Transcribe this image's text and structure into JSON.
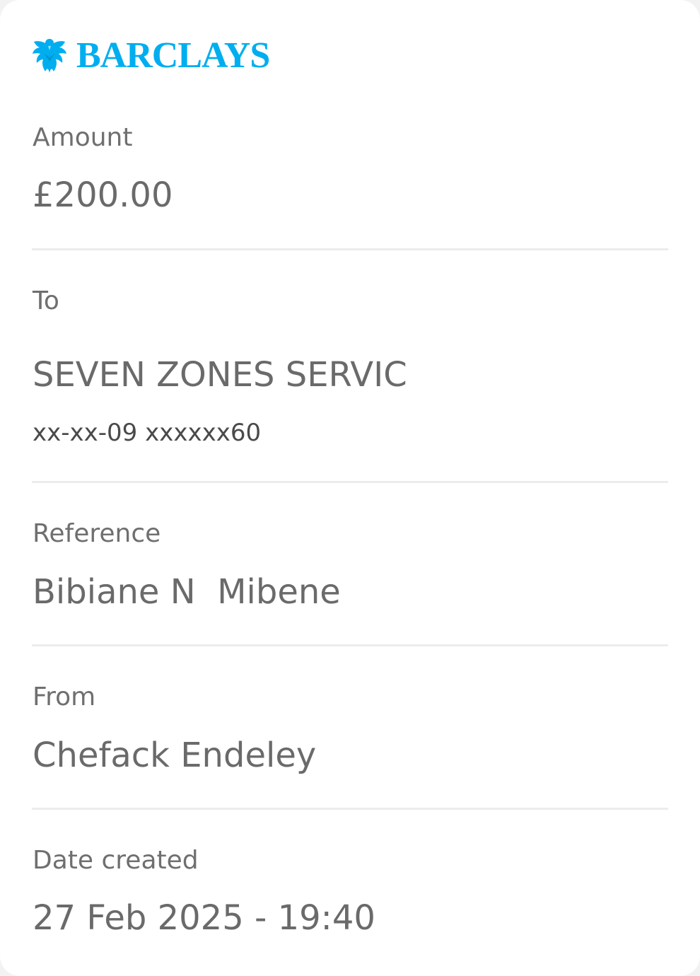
{
  "brand": {
    "name": "BARCLAYS",
    "logo_icon": "eagle-icon",
    "color": "#00aeef"
  },
  "payment": {
    "amount": {
      "label": "Amount",
      "value": "£200.00"
    },
    "to": {
      "label": "To",
      "name": "SEVEN ZONES SERVIC",
      "account": "xx-xx-09 xxxxxx60"
    },
    "reference": {
      "label": "Reference",
      "value": "Bibiane N  Mibene"
    },
    "from": {
      "label": "From",
      "value": "Chefack Endeley"
    },
    "date_created": {
      "label": "Date created",
      "value": "27 Feb 2025 - 19:40"
    }
  }
}
